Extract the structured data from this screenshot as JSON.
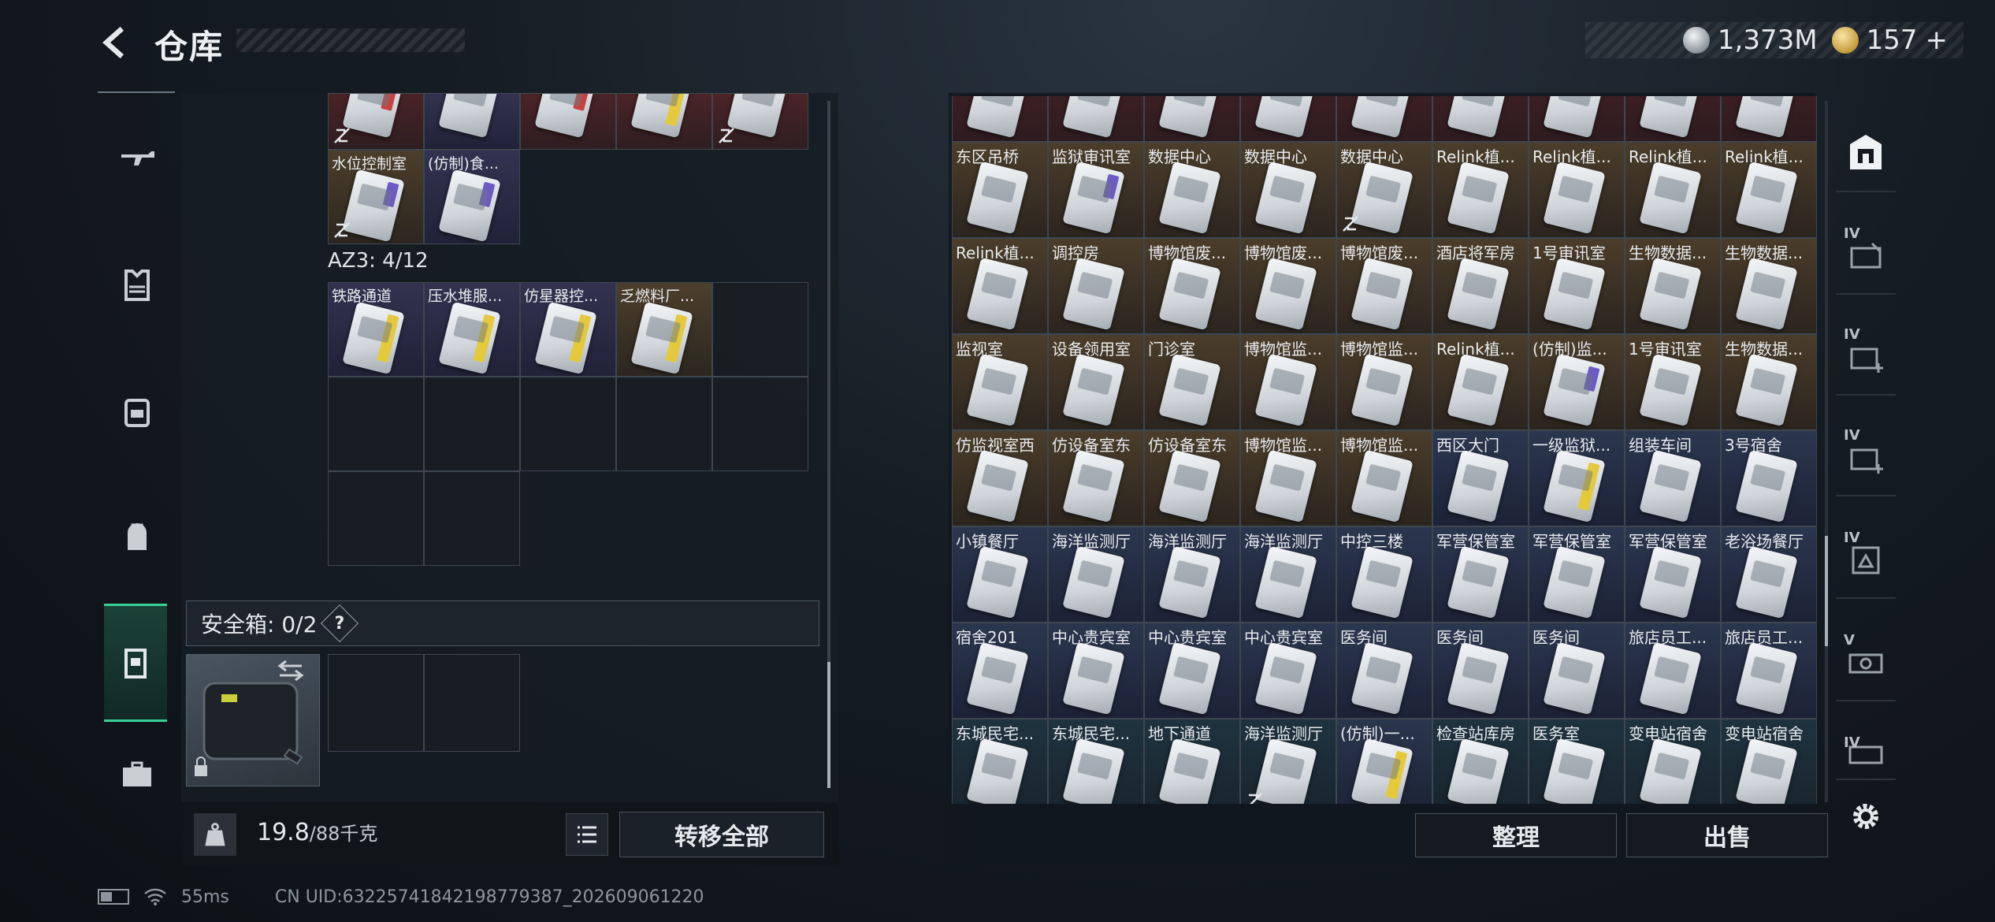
{
  "header": {
    "title": "仓库",
    "currency_silver": "1,373M",
    "currency_gold": "157",
    "currency_gold_plus": "+"
  },
  "left_nav": {
    "items": [
      "rifle-icon",
      "armor-icon",
      "backpack-icon",
      "bag-icon",
      "safebox-icon",
      "toolbox-icon"
    ],
    "selected": "safebox-icon"
  },
  "left_panel": {
    "top_row_labels": [
      "水位控制室",
      "(仿制)食..."
    ],
    "az3_label": "AZ3: 4/12",
    "az3_items": [
      "铁路通道",
      "压水堆服...",
      "仿星器控...",
      "乏燃料厂..."
    ],
    "safebox_label": "安全箱: 0/2",
    "safebox_help": "?",
    "weight_current": "19.8",
    "weight_max": "/88千克",
    "transfer_all": "转移全部"
  },
  "status": {
    "ping": "55ms",
    "uid": "CN UID:63225741842198779387_202609061220"
  },
  "right_panel": {
    "rows": [
      [
        "东区吊桥",
        "监狱审讯室",
        "数据中心",
        "数据中心",
        "数据中心",
        "Relink植...",
        "Relink植...",
        "Relink植...",
        "Relink植..."
      ],
      [
        "Relink植...",
        "调控房",
        "博物馆废...",
        "博物馆废...",
        "博物馆废...",
        "酒店将军房",
        "1号审讯室",
        "生物数据...",
        "生物数据..."
      ],
      [
        "监视室",
        "设备领用室",
        "门诊室",
        "博物馆监...",
        "博物馆监...",
        "Relink植...",
        "(仿制)监...",
        "1号审讯室",
        "生物数据..."
      ],
      [
        "仿监视室西",
        "仿设备室东",
        "仿设备室东",
        "博物馆监...",
        "博物馆监...",
        "西区大门",
        "一级监狱...",
        "组装车间",
        "3号宿舍"
      ],
      [
        "小镇餐厅",
        "海洋监测厅",
        "海洋监测厅",
        "海洋监测厅",
        "中控三楼",
        "军营保管室",
        "军营保管室",
        "军营保管室",
        "老浴场餐厅"
      ],
      [
        "宿舍201",
        "中心贵宾室",
        "中心贵宾室",
        "中心贵宾室",
        "医务间",
        "医务间",
        "医务间",
        "旅店员工...",
        "旅店员工..."
      ],
      [
        "东城民宅...",
        "东城民宅...",
        "地下通道",
        "海洋监测厅",
        "(仿制)一...",
        "检查站库房",
        "医务室",
        "变电站宿舍",
        "变电站宿舍"
      ]
    ],
    "sort_label": "整理",
    "sell_label": "出售"
  },
  "right_nav": {
    "tabs": [
      {
        "icon": "key-room-icon",
        "tier": ""
      },
      {
        "icon": "card-key-icon",
        "tier": "IV"
      },
      {
        "icon": "medkit-icon",
        "tier": "IV"
      },
      {
        "icon": "medkit-plus-icon",
        "tier": "IV"
      },
      {
        "icon": "ammo-icon",
        "tier": "IV"
      },
      {
        "icon": "case-icon",
        "tier": "V"
      },
      {
        "icon": "misc-icon",
        "tier": "IV"
      }
    ]
  }
}
